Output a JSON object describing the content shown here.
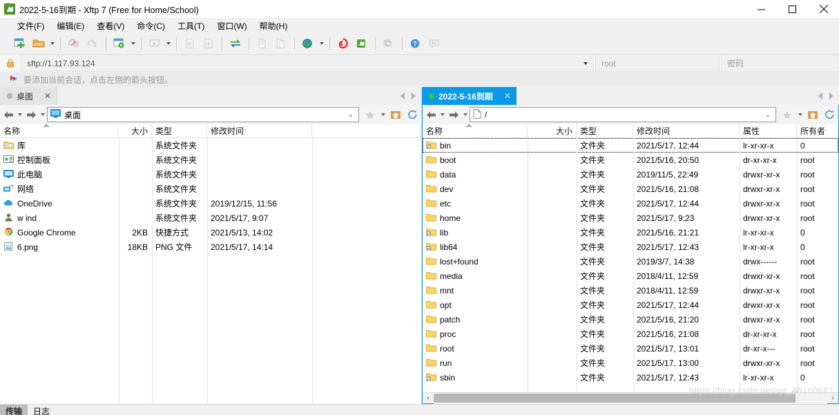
{
  "window": {
    "title": "2022-5-16到期 - Xftp 7 (Free for Home/School)",
    "app_icon": "xftp-icon",
    "minimize": "—",
    "maximize": "▢",
    "close": "✕"
  },
  "menu": [
    {
      "label": "文件(F)"
    },
    {
      "label": "编辑(E)"
    },
    {
      "label": "查看(V)"
    },
    {
      "label": "命令(C)"
    },
    {
      "label": "工具(T)"
    },
    {
      "label": "窗口(W)"
    },
    {
      "label": "帮助(H)"
    }
  ],
  "toolbar": {
    "buttons": [
      {
        "name": "new-session-icon"
      },
      {
        "name": "open-folder-icon"
      },
      {
        "name": "open-folder-dropdown-caret"
      },
      {
        "name": "disconnect-icon"
      },
      {
        "name": "reconnect-icon"
      },
      {
        "name": "session-settings-icon"
      },
      {
        "name": "session-settings-caret"
      },
      {
        "name": "run-icon"
      },
      {
        "name": "run-caret"
      },
      {
        "name": "transfer-left-icon"
      },
      {
        "name": "transfer-right-icon"
      },
      {
        "name": "sync-browsing-icon"
      },
      {
        "name": "copy-icon"
      },
      {
        "name": "paste-icon"
      },
      {
        "name": "globe-icon"
      },
      {
        "name": "globe-caret"
      },
      {
        "name": "xshell-icon"
      },
      {
        "name": "xftp-icon"
      },
      {
        "name": "options-gear-icon"
      },
      {
        "name": "help-icon"
      },
      {
        "name": "feedback-icon"
      }
    ]
  },
  "session_bar": {
    "lock_icon": "lock-icon",
    "url": "sftp://1.117.93.124",
    "username_placeholder": "root",
    "password_placeholder": "密码"
  },
  "hint": {
    "icon": "arrow-flag-icon",
    "text": "要添加当前会话，点击左侧的箭头按钮。"
  },
  "left_pane": {
    "tab": {
      "label": "桌面",
      "close": "✕",
      "status": "disconnected"
    },
    "path": "桌面",
    "path_icon": "desktop-icon",
    "columns": [
      "名称",
      "大小",
      "类型",
      "修改时间"
    ],
    "rows": [
      {
        "icon": "library-folder-icon",
        "name": "库",
        "size": "",
        "type": "系统文件夹",
        "modified": ""
      },
      {
        "icon": "control-panel-icon",
        "name": "控制面板",
        "size": "",
        "type": "系统文件夹",
        "modified": ""
      },
      {
        "icon": "this-pc-icon",
        "name": "此电脑",
        "size": "",
        "type": "系统文件夹",
        "modified": ""
      },
      {
        "icon": "network-icon",
        "name": "网络",
        "size": "",
        "type": "系统文件夹",
        "modified": ""
      },
      {
        "icon": "onedrive-icon",
        "name": "OneDrive",
        "size": "",
        "type": "系统文件夹",
        "modified": "2019/12/15, 11:56"
      },
      {
        "icon": "user-icon",
        "name": "w ind",
        "size": "",
        "type": "系统文件夹",
        "modified": "2021/5/17, 9:07"
      },
      {
        "icon": "chrome-icon",
        "name": "Google Chrome",
        "size": "2KB",
        "type": "快捷方式",
        "modified": "2021/5/13, 14:02"
      },
      {
        "icon": "png-file-icon",
        "name": "6.png",
        "size": "18KB",
        "type": "PNG 文件",
        "modified": "2021/5/17, 14:14"
      }
    ]
  },
  "right_pane": {
    "tab": {
      "label": "2022-5-16到期",
      "close": "✕",
      "status": "connected"
    },
    "path": "/",
    "path_icon": "file-icon",
    "columns": [
      "名称",
      "大小",
      "类型",
      "修改时间",
      "属性",
      "所有者"
    ],
    "rows": [
      {
        "icon": "link-folder-icon",
        "name": "bin",
        "size": "",
        "type": "文件夹",
        "modified": "2021/5/17, 12:44",
        "attr": "lr-xr-xr-x",
        "owner": "0",
        "selected": true
      },
      {
        "icon": "folder-icon",
        "name": "boot",
        "size": "",
        "type": "文件夹",
        "modified": "2021/5/16, 20:50",
        "attr": "dr-xr-xr-x",
        "owner": "root",
        "selected": false
      },
      {
        "icon": "folder-icon",
        "name": "data",
        "size": "",
        "type": "文件夹",
        "modified": "2019/11/5, 22:49",
        "attr": "drwxr-xr-x",
        "owner": "root",
        "selected": false
      },
      {
        "icon": "folder-icon",
        "name": "dev",
        "size": "",
        "type": "文件夹",
        "modified": "2021/5/16, 21:08",
        "attr": "drwxr-xr-x",
        "owner": "root",
        "selected": false
      },
      {
        "icon": "folder-icon",
        "name": "etc",
        "size": "",
        "type": "文件夹",
        "modified": "2021/5/17, 12:44",
        "attr": "drwxr-xr-x",
        "owner": "root",
        "selected": false
      },
      {
        "icon": "folder-icon",
        "name": "home",
        "size": "",
        "type": "文件夹",
        "modified": "2021/5/17, 9:23",
        "attr": "drwxr-xr-x",
        "owner": "root",
        "selected": false
      },
      {
        "icon": "link-folder-icon",
        "name": "lib",
        "size": "",
        "type": "文件夹",
        "modified": "2021/5/16, 21:21",
        "attr": "lr-xr-xr-x",
        "owner": "0",
        "selected": false
      },
      {
        "icon": "link-folder-icon",
        "name": "lib64",
        "size": "",
        "type": "文件夹",
        "modified": "2021/5/17, 12:43",
        "attr": "lr-xr-xr-x",
        "owner": "0",
        "selected": false
      },
      {
        "icon": "folder-icon",
        "name": "lost+found",
        "size": "",
        "type": "文件夹",
        "modified": "2019/3/7, 14:38",
        "attr": "drwx------",
        "owner": "root",
        "selected": false
      },
      {
        "icon": "folder-icon",
        "name": "media",
        "size": "",
        "type": "文件夹",
        "modified": "2018/4/11, 12:59",
        "attr": "drwxr-xr-x",
        "owner": "root",
        "selected": false
      },
      {
        "icon": "folder-icon",
        "name": "mnt",
        "size": "",
        "type": "文件夹",
        "modified": "2018/4/11, 12:59",
        "attr": "drwxr-xr-x",
        "owner": "root",
        "selected": false
      },
      {
        "icon": "folder-icon",
        "name": "opt",
        "size": "",
        "type": "文件夹",
        "modified": "2021/5/17, 12:44",
        "attr": "drwxr-xr-x",
        "owner": "root",
        "selected": false
      },
      {
        "icon": "folder-icon",
        "name": "patch",
        "size": "",
        "type": "文件夹",
        "modified": "2021/5/16, 21:20",
        "attr": "drwxr-xr-x",
        "owner": "root",
        "selected": false
      },
      {
        "icon": "folder-icon",
        "name": "proc",
        "size": "",
        "type": "文件夹",
        "modified": "2021/5/16, 21:08",
        "attr": "dr-xr-xr-x",
        "owner": "root",
        "selected": false
      },
      {
        "icon": "folder-icon",
        "name": "root",
        "size": "",
        "type": "文件夹",
        "modified": "2021/5/17, 13:01",
        "attr": "dr-xr-x---",
        "owner": "root",
        "selected": false
      },
      {
        "icon": "folder-icon",
        "name": "run",
        "size": "",
        "type": "文件夹",
        "modified": "2021/5/17, 13:00",
        "attr": "drwxr-xr-x",
        "owner": "root",
        "selected": false
      },
      {
        "icon": "link-folder-icon",
        "name": "sbin",
        "size": "",
        "type": "文件夹",
        "modified": "2021/5/17, 12:43",
        "attr": "lr-xr-xr-x",
        "owner": "0",
        "selected": false
      }
    ],
    "hscroll": {
      "left": "‹",
      "right": "›"
    }
  },
  "bottom_tabs": [
    {
      "label": "传输",
      "active": true
    },
    {
      "label": "日志",
      "active": false
    }
  ],
  "watermark": "https://blog.csdn.net/qq_46160687",
  "colors": {
    "active_tab": "#0b9ae6",
    "folder": "#fbd36b",
    "connected_dot": "#2ecc2e",
    "accent_border": "#2196d4"
  }
}
